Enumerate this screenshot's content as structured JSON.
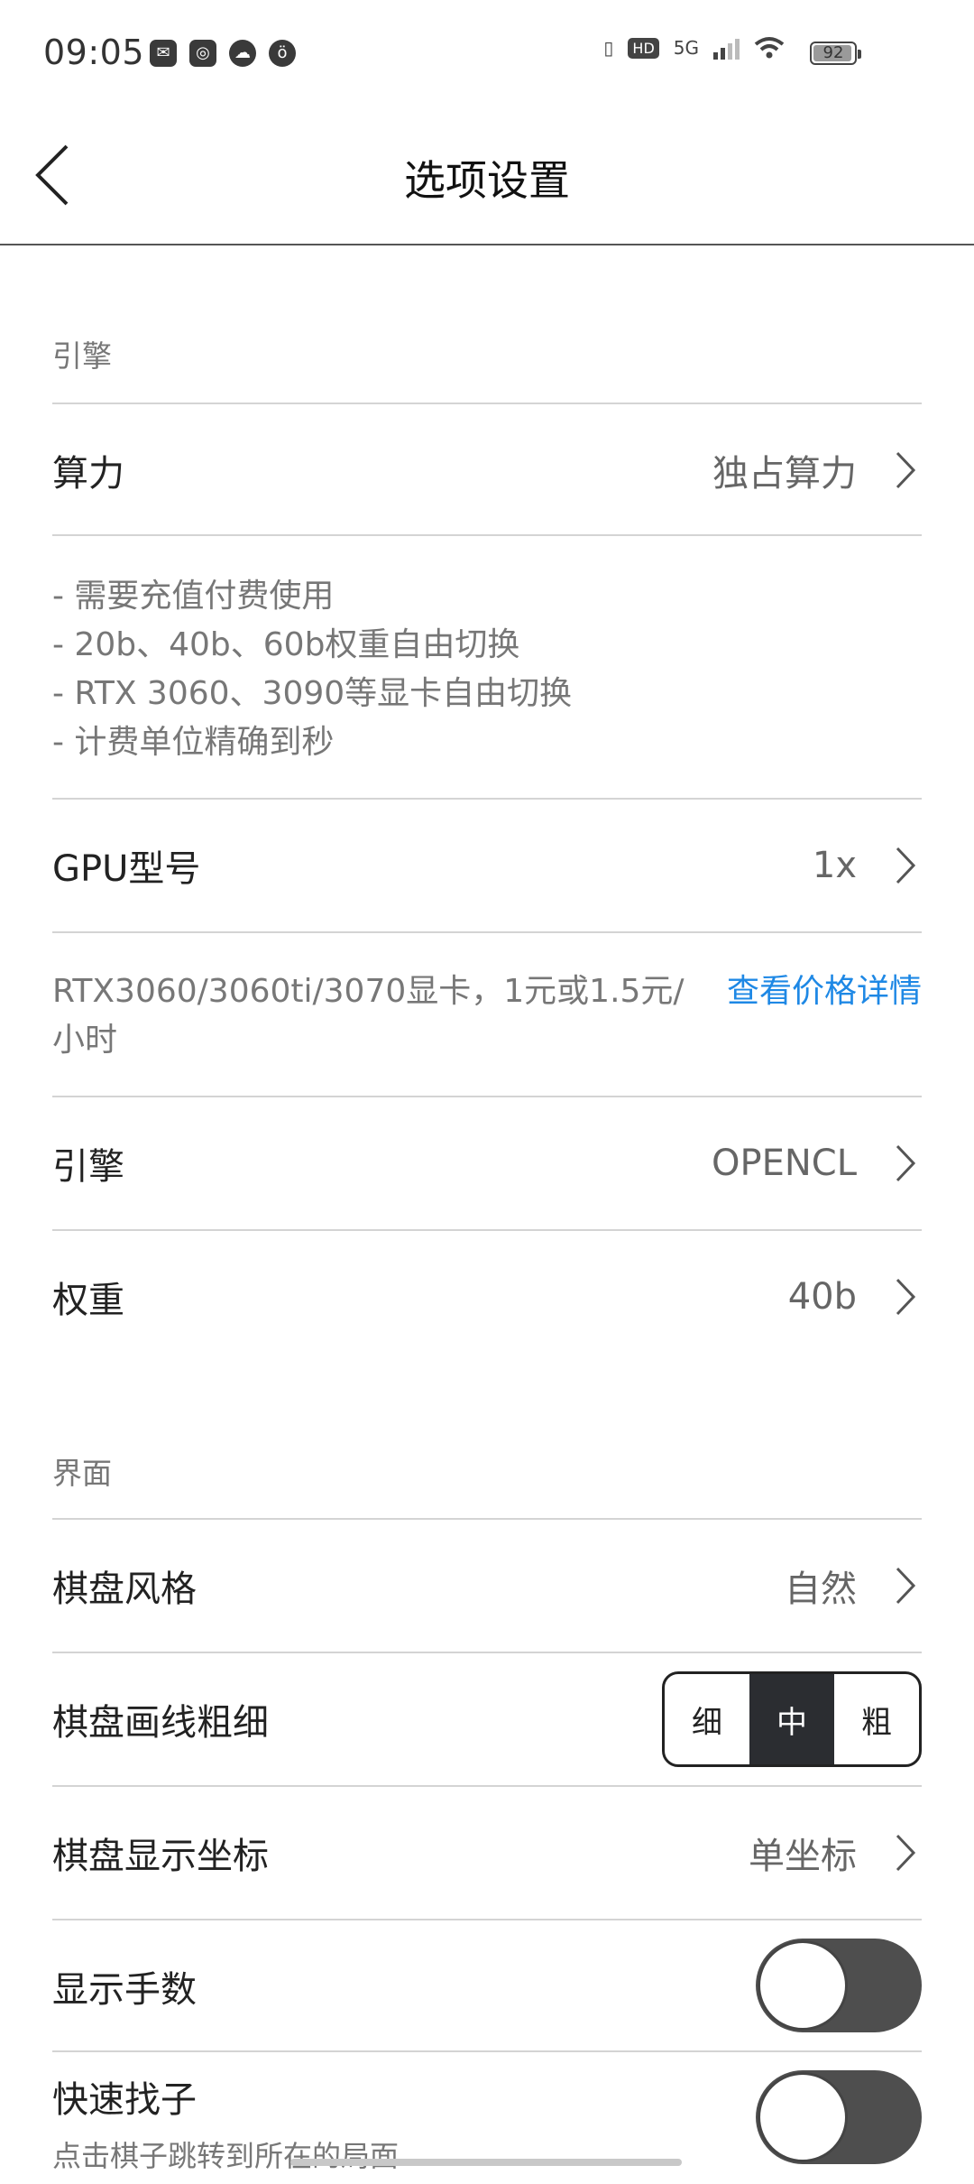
{
  "status_bar": {
    "time": "09:05",
    "left_icons": [
      "mail-icon",
      "globe-icon",
      "cloud-icon",
      "owl-icon"
    ],
    "network": "5G",
    "hd_label": "HD",
    "battery": "92"
  },
  "header": {
    "title": "选项设置"
  },
  "engine_section": {
    "label": "引擎",
    "compute": {
      "label": "算力",
      "value": "独占算力"
    },
    "compute_notes": [
      "- 需要充值付费使用",
      "- 20b、40b、60b权重自由切换",
      "- RTX 3060、3090等显卡自由切换",
      "- 计费单位精确到秒"
    ],
    "gpu": {
      "label": "GPU型号",
      "value": "1x"
    },
    "gpu_note": "RTX3060/3060ti/3070显卡，1元或1.5元/小时",
    "gpu_link": "查看价格详情",
    "engine": {
      "label": "引擎",
      "value": "OPENCL"
    },
    "weights": {
      "label": "权重",
      "value": "40b"
    }
  },
  "ui_section": {
    "label": "界面",
    "board_style": {
      "label": "棋盘风格",
      "value": "自然"
    },
    "line_width": {
      "label": "棋盘画线粗细",
      "options": [
        "细",
        "中",
        "粗"
      ],
      "selected": "中"
    },
    "coords": {
      "label": "棋盘显示坐标",
      "value": "单坐标"
    },
    "show_moves": {
      "label": "显示手数",
      "on": false
    },
    "quick_find": {
      "label": "快速找子",
      "sub": "点击棋子跳转到所在的局面",
      "on": false
    }
  }
}
